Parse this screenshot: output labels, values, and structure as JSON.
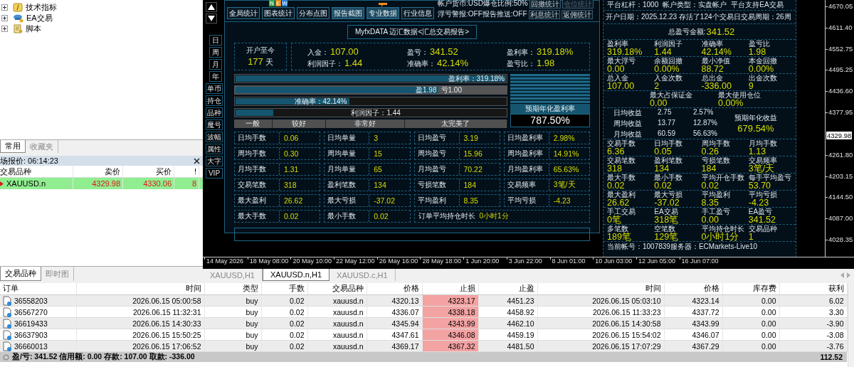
{
  "navigator": {
    "items": [
      {
        "label": "技术指标",
        "expanded": false
      },
      {
        "label": "EA交易",
        "expanded": false
      },
      {
        "label": "脚本",
        "expanded": false
      }
    ]
  },
  "left_tabs": [
    {
      "label": "常用",
      "selected": true
    },
    {
      "label": "收藏夹",
      "selected": false
    }
  ],
  "market_watch": {
    "title": "场报价: 06:14:23",
    "columns": [
      "交易品种",
      "卖价",
      "买价",
      "!"
    ],
    "rows": [
      {
        "symbol": "XAUUSD.n",
        "bid": "4329.98",
        "ask": "4330.06",
        "spread": "8",
        "selected": true
      }
    ]
  },
  "bottom_left_tabs": [
    {
      "label": "交易品种",
      "selected": true
    },
    {
      "label": "即时图",
      "selected": false
    }
  ],
  "side_buttons": [
    "日",
    "周",
    "月",
    "年",
    "单币",
    "持仓",
    "品种",
    "魔号",
    "波幅",
    "属性",
    "大字",
    "VIP"
  ],
  "report": {
    "toolbar": [
      {
        "label": "全局统计",
        "selected": false
      },
      {
        "label": "图表统计",
        "selected": false,
        "badge": [
          {
            "text": "N",
            "color": "#3aa54a"
          },
          {
            "text": "E",
            "color": "#e08a1e"
          },
          {
            "text": "W",
            "color": "#2f7fd0"
          }
        ]
      },
      {
        "label": "分布点图",
        "selected": false
      },
      {
        "label": "报告截图",
        "selected": true
      },
      {
        "label": "专业数据",
        "selected": true
      },
      {
        "label": "行业信息",
        "selected": false
      }
    ],
    "info_lines": [
      {
        "text": "帐户货币:USD爆仓比例:50%",
        "buttons": [
          {
            "label": "回撤统计",
            "disabled": false
          },
          {
            "label": "仓位统计",
            "disabled": true
          }
        ]
      },
      {
        "text": "浮亏警报:OFF报告推送:OFF",
        "buttons": [
          {
            "label": "利息统计",
            "disabled": false
          },
          {
            "label": "返佣统计",
            "disabled": false
          }
        ]
      }
    ],
    "title": "MyfxDATA 迈汇数据<汇总交易报告>",
    "since_label": "开户至今",
    "since_value": "177",
    "since_unit": "天",
    "summary": [
      {
        "label": "入金：",
        "value": "107.00"
      },
      {
        "label": "盈亏：",
        "value": "341.52"
      },
      {
        "label": "盈利率：",
        "value": "319.18%"
      },
      {
        "label": "利润因子：",
        "value": "1.44"
      },
      {
        "label": "准确率：",
        "value": "42.14%"
      },
      {
        "label": "盈亏比：",
        "value": "1.98"
      }
    ],
    "bars": [
      {
        "kind": "single",
        "label": "盈利率：319.18%",
        "level": 1
      },
      {
        "kind": "split",
        "label": "盈1.98",
        "label_2": "亏1.00",
        "level": 0.75
      },
      {
        "kind": "single",
        "label": "准确率：42.14%",
        "level": 0.42
      },
      {
        "kind": "single",
        "label": "利润因子：1.44",
        "level": 0.14
      }
    ],
    "scale": [
      "一般",
      "较好",
      "非常好",
      "太完美了"
    ],
    "annual_label": "预期年化盈利率",
    "annual_value": "787.50%",
    "stats": [
      {
        "kind": "cell",
        "label": "日均手数",
        "value": "0.06"
      },
      {
        "kind": "cell",
        "label": "日均单量",
        "value": "3"
      },
      {
        "kind": "cell",
        "label": "日均盈亏",
        "value": "3.19"
      },
      {
        "kind": "cell",
        "label": "日均盈利率",
        "value": "2.98%"
      },
      {
        "kind": "cell",
        "label": "周均手数",
        "value": "0.30"
      },
      {
        "kind": "cell",
        "label": "周均单量",
        "value": "15"
      },
      {
        "kind": "cell",
        "label": "周均盈亏",
        "value": "15.96"
      },
      {
        "kind": "cell",
        "label": "周均盈利率",
        "value": "14.91%"
      },
      {
        "kind": "cell",
        "label": "月均手数",
        "value": "1.31"
      },
      {
        "kind": "cell",
        "label": "月均单量",
        "value": "65"
      },
      {
        "kind": "cell",
        "label": "月均盈亏",
        "value": "70.22"
      },
      {
        "kind": "cell",
        "label": "月均盈利率",
        "value": "65.63%"
      },
      {
        "kind": "cell",
        "label": "交易笔数",
        "value": "318"
      },
      {
        "kind": "cell",
        "label": "盈利笔数",
        "value": "134"
      },
      {
        "kind": "cell",
        "label": "亏损笔数",
        "value": "184"
      },
      {
        "kind": "cell",
        "label": "交易频率",
        "value": "3笔/天"
      },
      {
        "kind": "cell",
        "label": "最大盈利",
        "value": "26.62"
      },
      {
        "kind": "cell",
        "label": "最大亏损",
        "value": "-37.02"
      },
      {
        "kind": "cell",
        "label": "平均盈利",
        "value": "8.35"
      },
      {
        "kind": "cell",
        "label": "平均亏损",
        "value": "-4.23"
      },
      {
        "kind": "cell",
        "label": "最大手数",
        "value": "0.02"
      },
      {
        "kind": "cell",
        "label": "最小手数",
        "value": "0.02"
      },
      {
        "kind": "wide",
        "label": "订单平均持仓时长",
        "value": "0小时1分"
      }
    ]
  },
  "account_panel": {
    "info": [
      "平台杠杆：1000",
      "帐户类型：实盘帐户",
      "平台支持EA交易"
    ],
    "open_line": "开户日期：2025.12.23 存活了124个交易日交易周期：26周",
    "total_label": "总盈亏金额:",
    "total_value": "341.52",
    "sections": [
      {
        "kind": "grid",
        "items": [
          {
            "label": "盈利率",
            "value": "319.18%"
          },
          {
            "label": "利润因子",
            "value": "1.44"
          },
          {
            "label": "准确率",
            "value": "42.14%"
          },
          {
            "label": "盈亏比",
            "value": "1.98"
          }
        ]
      },
      {
        "kind": "grid",
        "items": [
          {
            "label": "最大浮亏",
            "value": "0.00"
          },
          {
            "label": "余额回撤",
            "value": "0.00%"
          },
          {
            "label": "最小净值",
            "value": "88.72"
          },
          {
            "label": "本金回撤",
            "value": "0.00%"
          }
        ]
      },
      {
        "kind": "grid",
        "items": [
          {
            "label": "总入金",
            "value": "107.00"
          },
          {
            "label": "入金次数",
            "value": "2"
          },
          {
            "label": "总出金",
            "value": "-336.00"
          },
          {
            "label": "出金次数",
            "value": "9"
          }
        ]
      },
      {
        "kind": "grid",
        "items": [
          {
            "label": "最大占保证金",
            "value": "0.00"
          },
          {
            "label": "最大使用仓位",
            "value": "0.00%"
          }
        ]
      },
      {
        "kind": "averages",
        "rows": [
          [
            "日均收益",
            "2.75",
            "2.57%"
          ],
          [
            "周均收益",
            "13.77",
            "12.87%"
          ],
          [
            "月均收益",
            "60.59",
            "56.63%"
          ]
        ],
        "annual_label": "预期年化收益",
        "annual_value": "679.54%"
      },
      {
        "kind": "grid",
        "items": [
          {
            "label": "交易手数",
            "value": "6.36"
          },
          {
            "label": "日均手数",
            "value": "0.05"
          },
          {
            "label": "周均手数",
            "value": "0.26"
          },
          {
            "label": "月均手数",
            "value": "1.13"
          }
        ]
      },
      {
        "kind": "grid",
        "items": [
          {
            "label": "交易笔数",
            "value": "318"
          },
          {
            "label": "盈利笔数",
            "value": "134"
          },
          {
            "label": "亏损笔数",
            "value": "184"
          },
          {
            "label": "交易频率",
            "value": "3笔/天"
          }
        ]
      },
      {
        "kind": "grid",
        "items": [
          {
            "label": "最大手数",
            "value": "0.02"
          },
          {
            "label": "最小手数",
            "value": "0.02"
          },
          {
            "label": "平均开仓手数",
            "value": "0.02"
          },
          {
            "label": "每手平均盈亏",
            "value": "53.70"
          }
        ]
      },
      {
        "kind": "grid",
        "items": [
          {
            "label": "最大盈利",
            "value": "26.62"
          },
          {
            "label": "最大亏损",
            "value": "-37.02"
          },
          {
            "label": "平均盈利",
            "value": "8.35"
          },
          {
            "label": "平均亏损",
            "value": "-4.23"
          }
        ]
      },
      {
        "kind": "grid",
        "items": [
          {
            "label": "手工交易",
            "value": "0笔"
          },
          {
            "label": "EA交易",
            "value": "318笔"
          },
          {
            "label": "手工盈亏",
            "value": "0.00"
          },
          {
            "label": "EA盈亏",
            "value": "341.52"
          }
        ]
      },
      {
        "kind": "grid",
        "items": [
          {
            "label": "多笔数",
            "value": "189笔"
          },
          {
            "label": "空笔数",
            "value": "129笔"
          },
          {
            "label": "平均持仓时长",
            "value": "0小时1分"
          },
          {
            "label": "交易品种",
            "value": "1"
          }
        ]
      }
    ],
    "account_line": "当前帐号：1007839服务器：ECMarkets-Live10"
  },
  "price_axis": [
    "4670.05",
    "4611.40",
    "4552.75",
    "4495.25",
    "4436.60",
    "4377.95",
    "4261.80",
    "4203.15",
    "4144.50",
    "4087.00",
    "4028.35"
  ],
  "current_price": "4329.98",
  "time_axis": [
    "14 May 2026",
    "18 May 08:00",
    "20 May 10:00",
    "22 May 12:00",
    "26 May 16:00",
    "28 May 18:00",
    "1 Jun 20:00",
    "3 Jun 22:00",
    "8 Jun 01:00",
    "10 Jun 03:00",
    "12 Jun 05:00",
    "16 Jun 07:00"
  ],
  "chart_tabs": [
    {
      "label": "XAUUSD,H1",
      "selected": false
    },
    {
      "label": "XAUUSD.n,H1",
      "selected": true
    },
    {
      "label": "XAUUSD.c,H1",
      "selected": false
    }
  ],
  "orders": {
    "columns": [
      "订单",
      "时间",
      "类型",
      "手数",
      "交易品种",
      "价格",
      "止损",
      "止盈",
      "时间",
      "价格",
      "库存费",
      "获利"
    ],
    "rows": [
      [
        "36558203",
        "2026.06.15 05:00:58",
        "buy",
        "0.02",
        "xauusd.n",
        "4320.13",
        "4323.17",
        "4451.23",
        "2026.06.15 05:03:10",
        "4323.14",
        "0.00",
        "6.02"
      ],
      [
        "36567270",
        "2026.06.15 11:32:31",
        "buy",
        "0.02",
        "xauusd.n",
        "4336.07",
        "4338.18",
        "4458.92",
        "2026.06.15 11:33:23",
        "4337.72",
        "0.00",
        "3.30"
      ],
      [
        "36619433",
        "2026.06.15 14:30:33",
        "buy",
        "0.02",
        "xauusd.n",
        "4345.94",
        "4343.99",
        "4462.10",
        "2026.06.15 14:30:58",
        "4343.99",
        "0.00",
        "-3.90"
      ],
      [
        "36637903",
        "2026.06.15 15:50:25",
        "buy",
        "0.02",
        "xauusd.n",
        "4347.61",
        "4346.08",
        "4459.19",
        "2026.06.15 15:54:02",
        "4346.07",
        "0.00",
        "-3.08"
      ],
      [
        "36660013",
        "2026.06.15 17:06:52",
        "buy",
        "0.02",
        "xauusd.n",
        "4369.17",
        "4367.32",
        "4481.50",
        "2026.06.15 17:07:29",
        "4367.29",
        "0.00",
        "-3.76"
      ]
    ],
    "summary": "盈/亏: 341.52 信用额: 0.00 存款: 107.00 取款: -336.00",
    "total": "112.52"
  }
}
